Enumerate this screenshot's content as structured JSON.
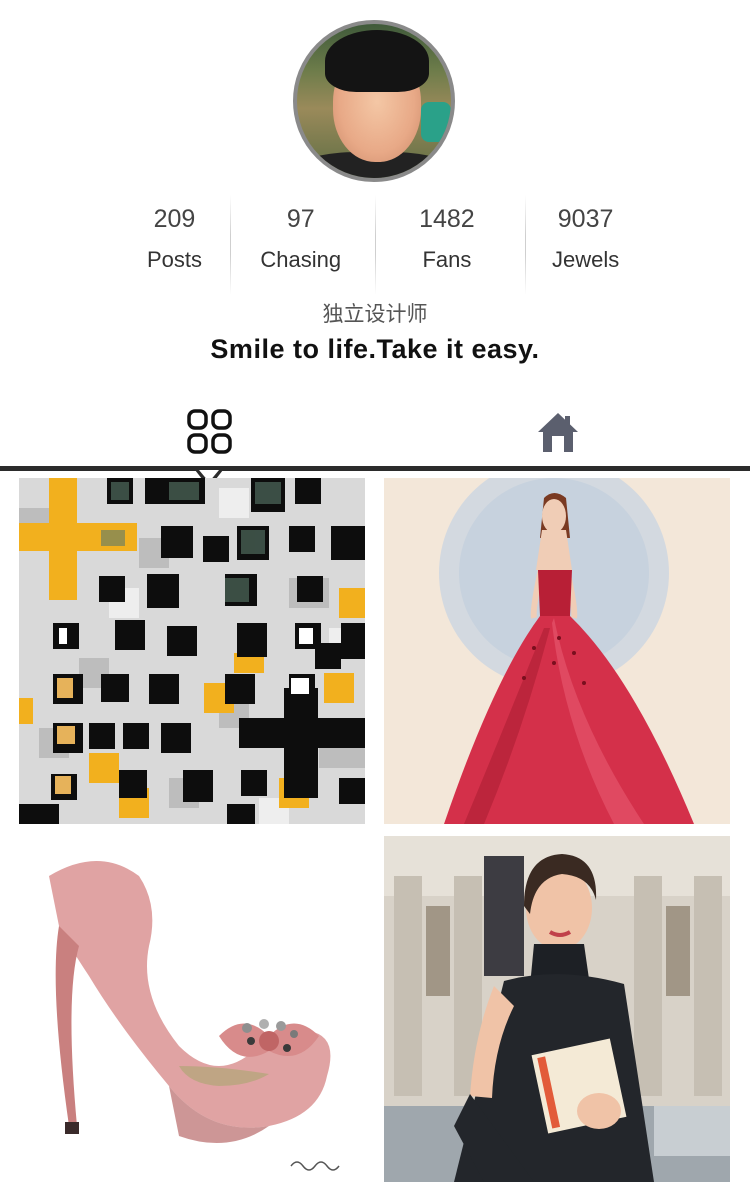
{
  "profile": {
    "avatar_icon": "user-avatar",
    "stats": [
      {
        "value": "209",
        "label": "Posts"
      },
      {
        "value": "97",
        "label": "Chasing"
      },
      {
        "value": "1482",
        "label": "Fans"
      },
      {
        "value": "9037",
        "label": "Jewels"
      }
    ],
    "title": "独立设计师",
    "motto": "Smile to life.Take it easy."
  },
  "tabs": [
    {
      "icon": "grid-icon",
      "active": true
    },
    {
      "icon": "home-icon",
      "active": false
    }
  ],
  "colors": {
    "tab_bar": "#2b2b2b",
    "icon_active": "#111111",
    "icon_inactive": "#5b5f6e",
    "accent_yellow": "#f2b01e",
    "dress_red": "#d4304a"
  },
  "gallery": [
    {
      "subject": "building-facade-image"
    },
    {
      "subject": "red-gown-illustration"
    },
    {
      "subject": "pink-heel-illustration"
    },
    {
      "subject": "street-style-photo"
    }
  ]
}
